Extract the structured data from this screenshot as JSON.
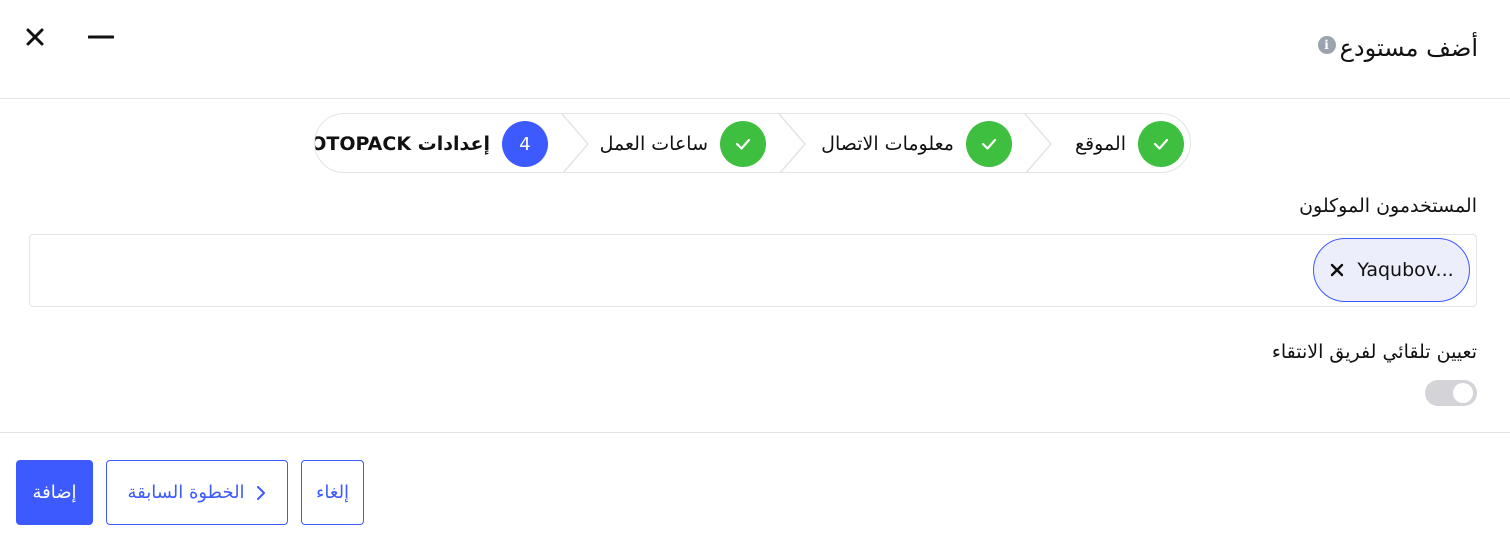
{
  "header": {
    "title": "أضف مستودع",
    "info_icon": "info-icon",
    "close_icon": "close-icon",
    "minimize_icon": "minimize-icon"
  },
  "stepper": {
    "steps": [
      {
        "label": "الموقع",
        "state": "done",
        "icon": "check-icon"
      },
      {
        "label": "معلومات الاتصال",
        "state": "done",
        "icon": "check-icon"
      },
      {
        "label": "ساعات العمل",
        "state": "done",
        "icon": "check-icon"
      },
      {
        "label": "إعدادات OTOPACK",
        "state": "active",
        "number": "4"
      }
    ]
  },
  "form": {
    "assigned_users_label": "المستخدمون الموكلون",
    "assigned_users": [
      {
        "name": "Yaqubov..."
      }
    ],
    "auto_assign_label": "تعيين تلقائي لفريق الانتقاء",
    "auto_assign_enabled": false
  },
  "footer": {
    "add_label": "إضافة",
    "prev_label": "الخطوة السابقة",
    "cancel_label": "إلغاء"
  },
  "colors": {
    "primary": "#3d5afe",
    "success": "#3fbf3f",
    "chip_bg": "#eceffb",
    "toggle_off": "#d4d4d8"
  }
}
